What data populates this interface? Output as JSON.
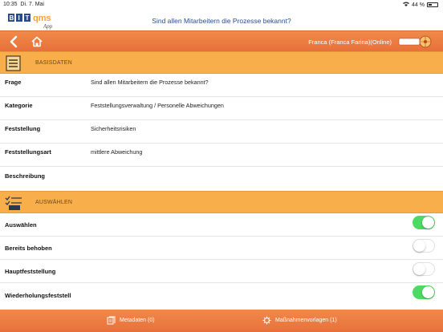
{
  "status": {
    "time": "10:35",
    "date": "Di. 7. Mai",
    "battery": "44 %"
  },
  "header": {
    "title": "Sind allen Mitarbeitern die Prozesse bekannt?",
    "logo_text": "BIT qms",
    "logo_sub": "App"
  },
  "nav": {
    "user": "Franca (Franca Farina)(Online)",
    "brand_text": ""
  },
  "basisdaten": {
    "label": "BASISDATEN",
    "rows": [
      {
        "label": "Frage",
        "value": "Sind allen Mitarbeitern die Prozesse bekannt?"
      },
      {
        "label": "Kategorie",
        "value": "Feststellungsverwaltung / Personelle Abweichungen"
      },
      {
        "label": "Feststellung",
        "value": "Sicherheitsrisiken"
      },
      {
        "label": "Feststellungsart",
        "value": "mittlere Abweichung"
      },
      {
        "label": "Beschreibung",
        "value": ""
      }
    ]
  },
  "auswaehlen": {
    "label": "AUSWÄHLEN",
    "rows": [
      {
        "label": "Auswählen",
        "on": true
      },
      {
        "label": "Bereits behoben",
        "on": false
      },
      {
        "label": "Hauptfeststellung",
        "on": false
      },
      {
        "label": "Wiederholungsfeststell",
        "on": true
      }
    ]
  },
  "bottom": {
    "metadaten": "Metadaten (0)",
    "massnahmen": "Maßnahmenvorlagen (1)"
  },
  "colors": {
    "nav": "#e8703a",
    "section": "#f7ae4b",
    "toggle_on": "#4cd964",
    "title": "#2b4c8c"
  }
}
